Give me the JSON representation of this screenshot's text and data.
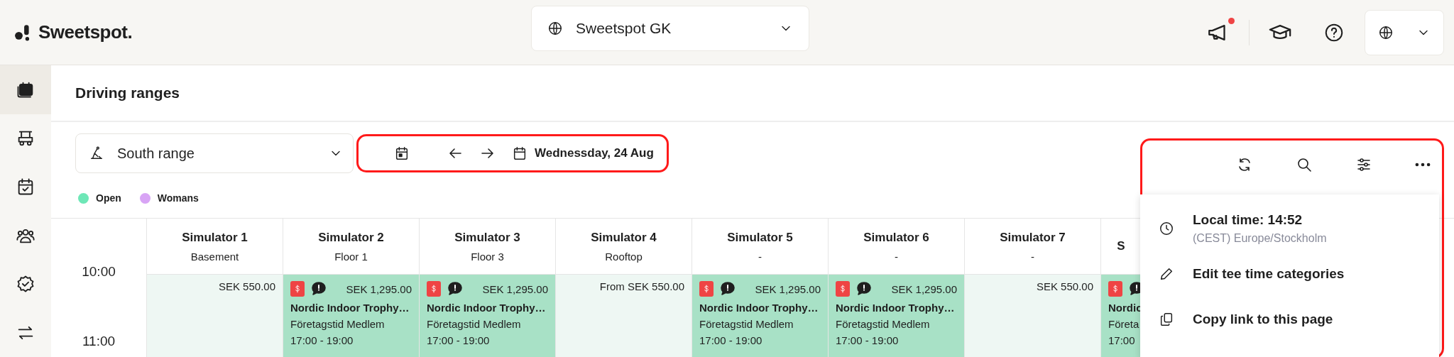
{
  "brand": {
    "name": "Sweetspot."
  },
  "organization_selector": {
    "value": "Sweetspot GK"
  },
  "header_actions": {
    "announcements_unread": true
  },
  "sidebar": {
    "items": [
      {
        "selected": true
      },
      {
        "selected": false
      },
      {
        "selected": false
      },
      {
        "selected": false
      },
      {
        "selected": false
      },
      {
        "selected": false
      }
    ]
  },
  "page": {
    "title": "Driving ranges"
  },
  "range_selector": {
    "value": "South range"
  },
  "date_navigator": {
    "highlighted": true,
    "date": "Wednessday, 24 Aug"
  },
  "legend": [
    {
      "label": "Open",
      "color": "#6ee7b7"
    },
    {
      "label": "Womans",
      "color": "#d8a4f5"
    }
  ],
  "toolbar_actions": {
    "highlighted": true
  },
  "menu": {
    "items": [
      {
        "kind": "info",
        "label": "Local time: 14:52",
        "detail": "(CEST) Europe/Stockholm"
      },
      {
        "kind": "edit",
        "label": "Edit tee time categories"
      },
      {
        "kind": "copy",
        "label": "Copy link to this page"
      }
    ]
  },
  "schedule": {
    "times": [
      "10:00",
      "11:00"
    ],
    "columns": [
      {
        "name": "Simulator 1",
        "subtitle": "Basement",
        "cell": {
          "kind": "open",
          "price": "SEK 550.00"
        }
      },
      {
        "name": "Simulator 2",
        "subtitle": "Floor 1",
        "cell": {
          "kind": "booking",
          "price": "SEK 1,295.00",
          "title": "Nordic Indoor Trophy…",
          "category": "Företagstid Medlem",
          "time": "17:00 - 19:00"
        }
      },
      {
        "name": "Simulator 3",
        "subtitle": "Floor 3",
        "cell": {
          "kind": "booking",
          "price": "SEK 1,295.00",
          "title": "Nordic Indoor Trophy…",
          "category": "Företagstid Medlem",
          "time": "17:00 - 19:00"
        }
      },
      {
        "name": "Simulator 4",
        "subtitle": "Rooftop",
        "cell": {
          "kind": "open",
          "price": "From SEK 550.00"
        }
      },
      {
        "name": "Simulator 5",
        "subtitle": "-",
        "cell": {
          "kind": "booking",
          "price": "SEK 1,295.00",
          "title": "Nordic Indoor Trophy…",
          "category": "Företagstid Medlem",
          "time": "17:00 - 19:00"
        }
      },
      {
        "name": "Simulator 6",
        "subtitle": "-",
        "cell": {
          "kind": "booking",
          "price": "SEK 1,295.00",
          "title": "Nordic Indoor Trophy…",
          "category": "Företagstid Medlem",
          "time": "17:00 - 19:00"
        }
      },
      {
        "name": "Simulator 7",
        "subtitle": "-",
        "cell": {
          "kind": "open",
          "price": "SEK 550.00"
        }
      },
      {
        "name": "S",
        "cell": {
          "kind": "booking",
          "title": "Nordic",
          "category": "Företa",
          "time": "17:00"
        }
      }
    ]
  }
}
